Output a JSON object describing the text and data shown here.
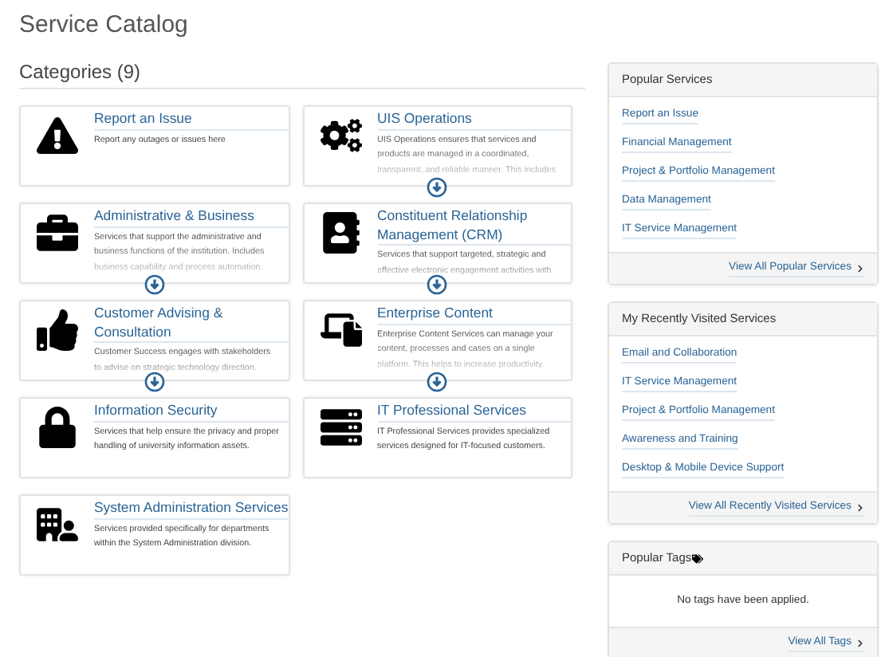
{
  "page_title": "Service Catalog",
  "categories_heading": "Categories (9)",
  "categories": [
    {
      "title": "Report an Issue",
      "description": [
        "Report any outages or issues here"
      ],
      "expandable": false
    },
    {
      "title": "UIS Operations",
      "description": [
        "UIS Operations ensures that services and",
        "products are managed in a coordinated,",
        "transparent, and reliable manner. This includes"
      ],
      "expandable": true
    },
    {
      "title": "Administrative & Business",
      "description": [
        "Services that support the administrative and",
        "business functions of the institution. Includes",
        "business capability and process automation."
      ],
      "expandable": true
    },
    {
      "title": "Constituent Relationship Management (CRM)",
      "description": [
        "Services that support targeted, strategic and",
        "effective electronic engagement activities with"
      ],
      "expandable": true
    },
    {
      "title": "Customer Advising & Consultation",
      "description": [
        "Customer Success engages with stakeholders",
        "to advise on strategic technology direction."
      ],
      "expandable": true
    },
    {
      "title": "Enterprise Content",
      "description": [
        "Enterprise Content Services can manage your",
        "content, processes and cases on a single",
        "platform. This helps to increase productivity."
      ],
      "expandable": true
    },
    {
      "title": "Information Security",
      "description": [
        "Services that help ensure the privacy and proper",
        "handling of university information assets."
      ],
      "expandable": false
    },
    {
      "title": "IT Professional Services",
      "description": [
        "IT Professional Services provides specialized",
        "services designed for IT-focused customers."
      ],
      "expandable": false
    },
    {
      "title": "System Administration Services",
      "description": [
        "Services provided specifically for departments",
        "within the System Administration division."
      ],
      "expandable": false
    }
  ],
  "panels": [
    {
      "title": "Popular Services",
      "tag_icon": false,
      "links": [
        "Report an Issue",
        "Financial Management",
        "Project & Portfolio Management",
        "Data Management",
        "IT Service Management"
      ],
      "footer_link": "View All Popular Services"
    },
    {
      "title": "My Recently Visited Services",
      "tag_icon": false,
      "links": [
        "Email and Collaboration",
        "IT Service Management",
        "Project & Portfolio Management",
        "Awareness and Training",
        "Desktop & Mobile Device Support"
      ],
      "footer_link": "View All Recently Visited Services"
    },
    {
      "title": "Popular Tags",
      "tag_icon": true,
      "empty_message": "No tags have been applied.",
      "footer_link": "View All Tags"
    }
  ]
}
